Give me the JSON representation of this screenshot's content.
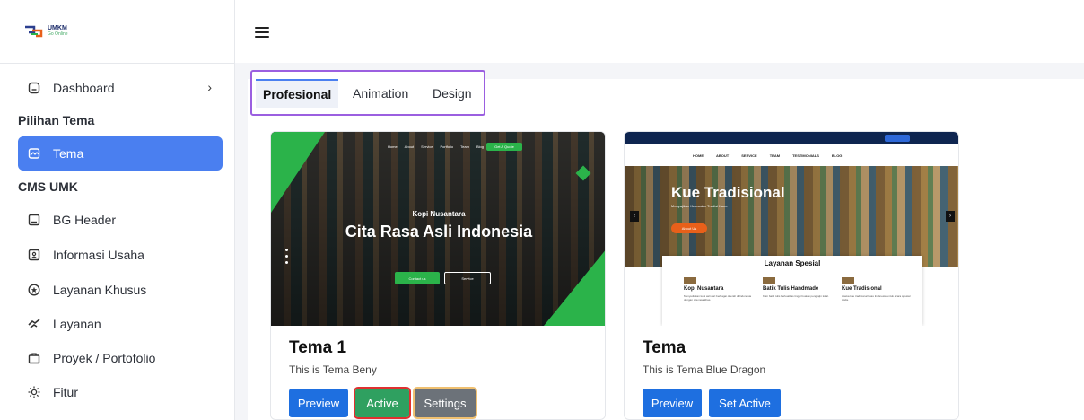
{
  "brand": {
    "name": "UMKM",
    "tagline": "Go Online"
  },
  "sidebar": {
    "dashboard": {
      "label": "Dashboard"
    },
    "sections": [
      {
        "title": "Pilihan Tema"
      },
      {
        "title": "CMS UMK"
      }
    ],
    "items": [
      {
        "label": "Tema",
        "icon": "palette-icon",
        "active": true
      },
      {
        "label": "BG Header",
        "icon": "image-icon"
      },
      {
        "label": "Informasi Usaha",
        "icon": "info-card-icon"
      },
      {
        "label": "Layanan Khusus",
        "icon": "star-circle-icon"
      },
      {
        "label": "Layanan",
        "icon": "handshake-icon"
      },
      {
        "label": "Proyek / Portofolio",
        "icon": "briefcase-icon"
      },
      {
        "label": "Fitur",
        "icon": "sun-icon"
      }
    ]
  },
  "tabs": [
    {
      "label": "Profesional",
      "active": true
    },
    {
      "label": "Animation"
    },
    {
      "label": "Design"
    }
  ],
  "themes": [
    {
      "title": "Tema 1",
      "description": "This is Tema Beny",
      "buttons": {
        "preview": "Preview",
        "active": "Active",
        "settings": "Settings"
      },
      "preview_content": {
        "nav": [
          "Home",
          "About",
          "Service",
          "Portfolio",
          "Team",
          "Blog"
        ],
        "quote_button": "Get A Quote",
        "kicker": "Kopi Nusantara",
        "headline": "Cita Rasa Asli Indonesia",
        "cta_primary": "Contact us",
        "cta_secondary": "Service"
      }
    },
    {
      "title": "Tema",
      "description": "This is Tema Blue Dragon",
      "buttons": {
        "preview": "Preview",
        "set_active": "Set Active"
      },
      "preview_content": {
        "nav": [
          "HOME",
          "ABOUT",
          "SERVICE",
          "TEAM",
          "TESTIMONIALS",
          "BLOG"
        ],
        "quote_button": "Get A Quote",
        "headline": "Kue Tradisional",
        "subline": "Menyajikan Kelezatan Tradisi Kuno",
        "cta": "About Us",
        "section_title": "Layanan Spesial",
        "services": [
          {
            "name": "Kopi Nusantara",
            "desc": "Menyediakan kopi asli dari berbagai daerah di Indonesia dengan cita rasa khas."
          },
          {
            "name": "Batik Tulis Handmade",
            "desc": "Kain batik tulis berkualitas tinggi buatan pengrajin lokal."
          },
          {
            "name": "Kue Tradisional",
            "desc": "Aneka kue tradisional khas Indonesia untuk acara spesial Anda."
          }
        ]
      }
    }
  ],
  "colors": {
    "primary": "#4a7ff0",
    "preview_button": "#1e6fe0",
    "active_button": "#2fa060",
    "settings_button": "#6c7279",
    "tab_highlight_border": "#9b5fe0",
    "theme1_accent": "#2bb34a",
    "theme2_accent": "#e8601a"
  }
}
